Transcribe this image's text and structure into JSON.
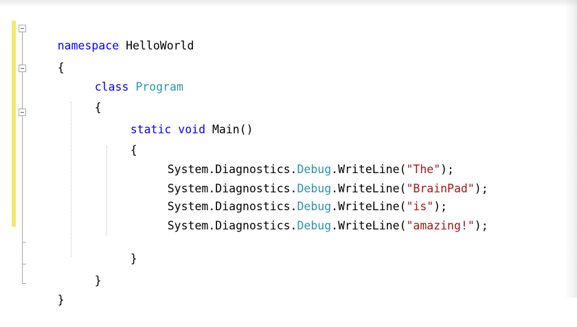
{
  "colors": {
    "keyword": "#0000ff",
    "type": "#2b91af",
    "string": "#a31515",
    "text": "#000000",
    "change_margin": "#f5e96a"
  },
  "code": {
    "line1": {
      "keyword": "namespace",
      "name": " HelloWorld"
    },
    "line2": {
      "text": "{"
    },
    "line3": {
      "keyword": "class",
      "type": "Program"
    },
    "line4": {
      "text": "{"
    },
    "line5": {
      "keyword1": "static",
      "keyword2": "void",
      "text": "Main()"
    },
    "line6": {
      "text": "{"
    },
    "calls": [
      {
        "prefix": "System.Diagnostics.",
        "type": "Debug",
        "method": ".WriteLine(",
        "arg": "\"The\"",
        "suffix": ");"
      },
      {
        "prefix": "System.Diagnostics.",
        "type": "Debug",
        "method": ".WriteLine(",
        "arg": "\"BrainPad\"",
        "suffix": ");"
      },
      {
        "prefix": "System.Diagnostics.",
        "type": "Debug",
        "method": ".WriteLine(",
        "arg": "\"is\"",
        "suffix": ");"
      },
      {
        "prefix": "System.Diagnostics.",
        "type": "Debug",
        "method": ".WriteLine(",
        "arg": "\"amazing!\"",
        "suffix": ");"
      }
    ],
    "line11": {
      "text": "}"
    },
    "line12": {
      "text": "}"
    },
    "line13": {
      "text": "}"
    }
  },
  "icons": {
    "fold": "collapse-minus-icon"
  }
}
